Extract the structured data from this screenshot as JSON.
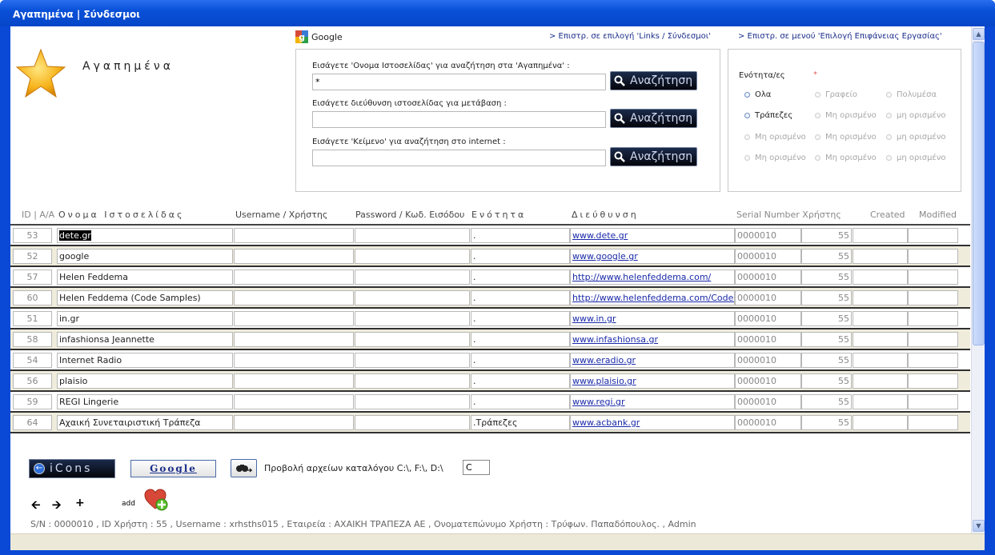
{
  "window": {
    "title": "Αγαπημένα | Σύνδεσμοι"
  },
  "header": {
    "page_title": "Αγαπημένα",
    "google_link": "Google",
    "nav_links": [
      "> Επιστρ. σε επιλογή 'Links / Σύνδεσμοι'",
      "> Επιστρ. σε μενού 'Επιλογή Επιφάνειας Εργασίας'"
    ]
  },
  "search": {
    "rows": [
      {
        "label": "Εισάγετε 'Ονομα Ιστοσελίδας' για αναζήτηση στα 'Αγαπημένα' :",
        "value": "*",
        "button": "Αναζήτηση"
      },
      {
        "label": "Εισάγετε διεύθυνση ιστοσελίδας για μετάβαση :",
        "value": "",
        "button": "Αναζήτηση"
      },
      {
        "label": "Εισάγετε 'Κείμενο' για αναζήτηση στο internet :",
        "value": "",
        "button": "Αναζήτηση"
      }
    ]
  },
  "sections": {
    "heading": "Ενότητα/ες",
    "required_mark": "*",
    "options": [
      [
        "Ολα",
        "Γραφείο",
        "Πολυμέσα"
      ],
      [
        "Τράπεζες",
        "Μη ορισμένο",
        "μη ορισμένο"
      ],
      [
        "Μη ορισμένο",
        "Μη ορισμένο",
        "μη ορισμένο"
      ],
      [
        "Μη ορισμένο",
        "Μη ορισμένο",
        "μη ορισμένο"
      ]
    ]
  },
  "table": {
    "headers": {
      "id": "ID | Α/Α",
      "name": "Ονομα Ιστοσελίδας",
      "user": "Username / Χρήστης",
      "pass": "Password / Κωδ. Εισόδου",
      "sect": "Ενότητα",
      "url": "Διεύθυνση",
      "serial": "Serial Number Χρήστης",
      "created": "Created",
      "modified": "Modified"
    },
    "rows": [
      {
        "id": "53",
        "name": "dete.gr",
        "user": "",
        "pass": "",
        "sect": ".",
        "url": "www.dete.gr",
        "serial": "0000010",
        "xr": "55",
        "created": "",
        "modified": ""
      },
      {
        "id": "52",
        "name": "google",
        "user": "",
        "pass": "",
        "sect": ".",
        "url": "www.google.gr",
        "serial": "0000010",
        "xr": "55",
        "created": "",
        "modified": ""
      },
      {
        "id": "57",
        "name": "Helen Feddema",
        "user": "",
        "pass": "",
        "sect": ".",
        "url": "http://www.helenfeddema.com/",
        "serial": "0000010",
        "xr": "55",
        "created": "",
        "modified": ""
      },
      {
        "id": "60",
        "name": "Helen Feddema (Code Samples)",
        "user": "",
        "pass": "",
        "sect": ".",
        "url": "http://www.helenfeddema.com/CodeSamples",
        "serial": "0000010",
        "xr": "55",
        "created": "",
        "modified": ""
      },
      {
        "id": "51",
        "name": "in.gr",
        "user": "",
        "pass": "",
        "sect": ".",
        "url": "www.in.gr",
        "serial": "0000010",
        "xr": "55",
        "created": "",
        "modified": ""
      },
      {
        "id": "58",
        "name": "infashionsa Jeannette",
        "user": "",
        "pass": "",
        "sect": ".",
        "url": "www.infashionsa.gr",
        "serial": "0000010",
        "xr": "55",
        "created": "",
        "modified": ""
      },
      {
        "id": "54",
        "name": "Internet Radio",
        "user": "",
        "pass": "",
        "sect": ".",
        "url": "www.eradio.gr",
        "serial": "0000010",
        "xr": "55",
        "created": "",
        "modified": ""
      },
      {
        "id": "56",
        "name": "plaisio",
        "user": "",
        "pass": "",
        "sect": ".",
        "url": "www.plaisio.gr",
        "serial": "0000010",
        "xr": "55",
        "created": "",
        "modified": ""
      },
      {
        "id": "59",
        "name": "REGI Lingerie",
        "user": "",
        "pass": "",
        "sect": ".",
        "url": "www.regi.gr",
        "serial": "0000010",
        "xr": "55",
        "created": "",
        "modified": ""
      },
      {
        "id": "64",
        "name": "Αχαική Συνεταιριστική Τράπεζα",
        "user": "",
        "pass": "",
        "sect": ".Τράπεζες",
        "url": "www.acbank.gr",
        "serial": "0000010",
        "xr": "55",
        "created": "",
        "modified": ""
      }
    ]
  },
  "toolbar": {
    "icons_button": "iCons",
    "google_button": "Google",
    "dir_label": "Προβολή αρχείων καταλόγου C:\\, F:\\, D:\\",
    "dir_value": "C",
    "add_label": "add"
  },
  "footer": {
    "info": "S/N : 0000010 , ID Χρήστη : 55 , Username : xrhsths015 , Εταιρεία : ΑΧΑΙΚΗ ΤΡΑΠΕΖΑ ΑΕ , Ονοματεπώνυμο Χρήστη : Τρύφων. Παπαδόπουλος. , Admin"
  },
  "colors": {
    "titlebar": "#0850d8",
    "link": "#1a2aa8",
    "row_alt": "#efecdc",
    "button_dark": "#05060b"
  }
}
